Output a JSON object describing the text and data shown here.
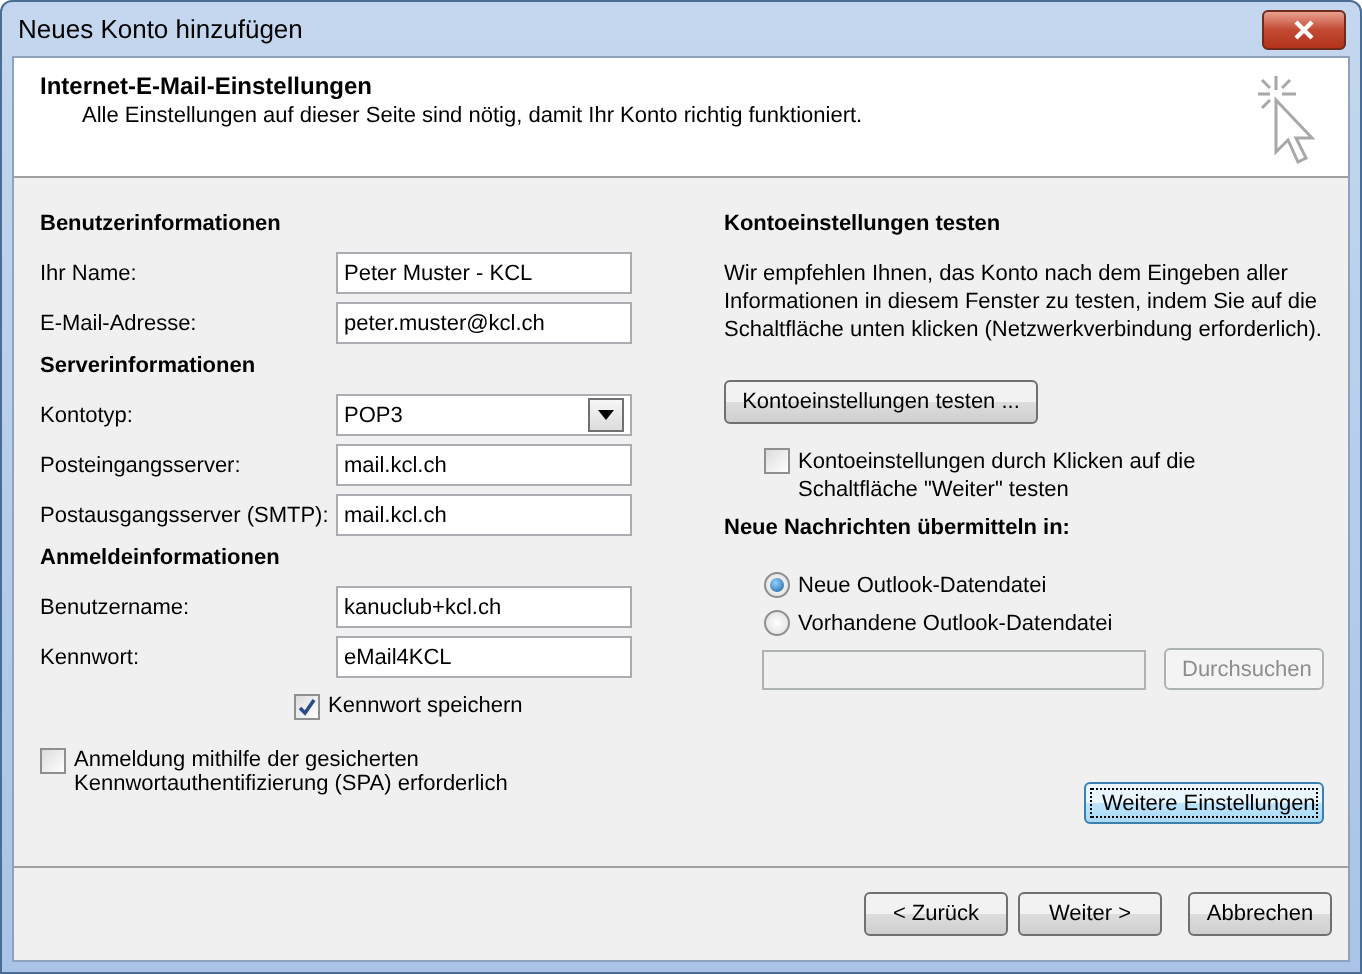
{
  "window": {
    "title": "Neues Konto hinzufügen"
  },
  "header": {
    "title": "Internet-E-Mail-Einstellungen",
    "subtitle": "Alle Einstellungen auf dieser Seite sind nötig, damit Ihr Konto richtig funktioniert."
  },
  "sections": [
    {
      "heading": "Benutzerinformationen",
      "fields": [
        {
          "label": "Ihr Name:",
          "value": "Peter Muster - KCL",
          "kind": "text"
        },
        {
          "label": "E-Mail-Adresse:",
          "value": "peter.muster@kcl.ch",
          "kind": "text"
        }
      ]
    },
    {
      "heading": "Serverinformationen",
      "fields": [
        {
          "label": "Kontotyp:",
          "value": "POP3",
          "kind": "dropdown"
        },
        {
          "label": "Posteingangsserver:",
          "value": "mail.kcl.ch",
          "kind": "text"
        },
        {
          "label": "Postausgangsserver (SMTP):",
          "value": "mail.kcl.ch",
          "kind": "text"
        }
      ]
    },
    {
      "heading": "Anmeldeinformationen",
      "fields": [
        {
          "label": "Benutzername:",
          "value": "kanuclub+kcl.ch",
          "kind": "text"
        },
        {
          "label": "Kennwort:",
          "value": "eMail4KCL",
          "kind": "text"
        }
      ]
    }
  ],
  "save_password": {
    "label": "Kennwort speichern",
    "checked": true
  },
  "spa": {
    "label": "Anmeldung mithilfe der gesicherten Kennwortauthentifizierung (SPA) erforderlich",
    "checked": false
  },
  "test": {
    "heading": "Kontoeinstellungen testen",
    "text": "Wir empfehlen Ihnen, das Konto nach dem Eingeben aller Informationen in diesem Fenster zu testen, indem Sie auf die Schaltfläche unten klicken (Netzwerkverbindung erforderlich).",
    "button": "Kontoeinstellungen testen ...",
    "checkbox": {
      "label": "Kontoeinstellungen durch Klicken auf die Schaltfläche \"Weiter\" testen",
      "checked": false
    }
  },
  "delivery": {
    "heading": "Neue Nachrichten übermitteln in:",
    "options": [
      {
        "label": "Neue Outlook-Datendatei",
        "selected": true
      },
      {
        "label": "Vorhandene Outlook-Datendatei",
        "selected": false
      }
    ],
    "file_field": {
      "disabled": true
    },
    "browse_button": {
      "label": "Durchsuchen",
      "disabled": true
    }
  },
  "more_button": {
    "label": "Weitere Einstellungen",
    "focused": true
  },
  "footer_buttons": [
    {
      "label": "< Zurück",
      "disabled": false
    },
    {
      "label": "Weiter >",
      "disabled": false
    },
    {
      "label": "Abbrechen",
      "disabled": false
    }
  ]
}
